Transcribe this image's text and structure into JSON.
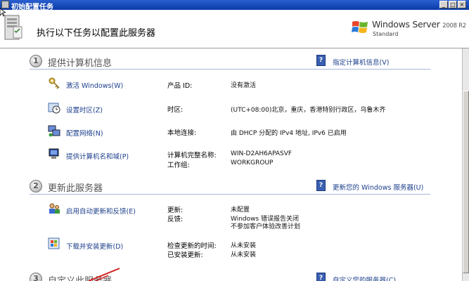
{
  "window": {
    "title": "初始配置任务"
  },
  "header": {
    "instruction": "执行以下任务以配置此服务器",
    "logo": {
      "brand": "Windows Server",
      "version": "2008 R2",
      "edition": "Standard"
    }
  },
  "sections": [
    {
      "number": "1",
      "title": "提供计算机信息",
      "link": "指定计算机信息(V)",
      "tasks": [
        {
          "label": "激活 Windows(W)"
        },
        {
          "label": "设置时区(Z)"
        },
        {
          "label": "配置网络(N)"
        },
        {
          "label": "提供计算机名和域(P)"
        }
      ],
      "info": [
        {
          "label": "产品 ID:",
          "value": "没有激活"
        },
        {
          "label": "时区:",
          "value": "(UTC+08:00)北京，重庆，香港特别行政区，乌鲁木齐"
        },
        {
          "label": "本地连接:",
          "value": "由 DHCP 分配的 IPv4 地址, IPv6 已启用"
        },
        {
          "label": "计算机完整名称:",
          "value": "WIN-D2AH6APASVF"
        },
        {
          "label": "工作组:",
          "value": "WORKGROUP"
        }
      ]
    },
    {
      "number": "2",
      "title": "更新此服务器",
      "link": "更新您的 Windows 服务器(U)",
      "tasks": [
        {
          "label": "启用自动更新和反馈(E)"
        },
        {
          "label": "下载并安装更新(D)"
        }
      ],
      "info": [
        {
          "label": "更新:",
          "value": "未配置"
        },
        {
          "label": "反馈:",
          "value": "Windows 错误报告关闭"
        },
        {
          "label": "",
          "value": "不参加客户体验改善计划"
        },
        {
          "label": "检查更新的时间:",
          "value": "从未安装"
        },
        {
          "label": "已安装更新:",
          "value": "从未安装"
        }
      ]
    },
    {
      "number": "3",
      "title": "自定义此服务器",
      "link": "自定义您的服务器(C)"
    }
  ],
  "colors": {
    "link": "#1c3f8c",
    "titlebar": "#0a3aa8",
    "divider": "#a8b8d8"
  }
}
